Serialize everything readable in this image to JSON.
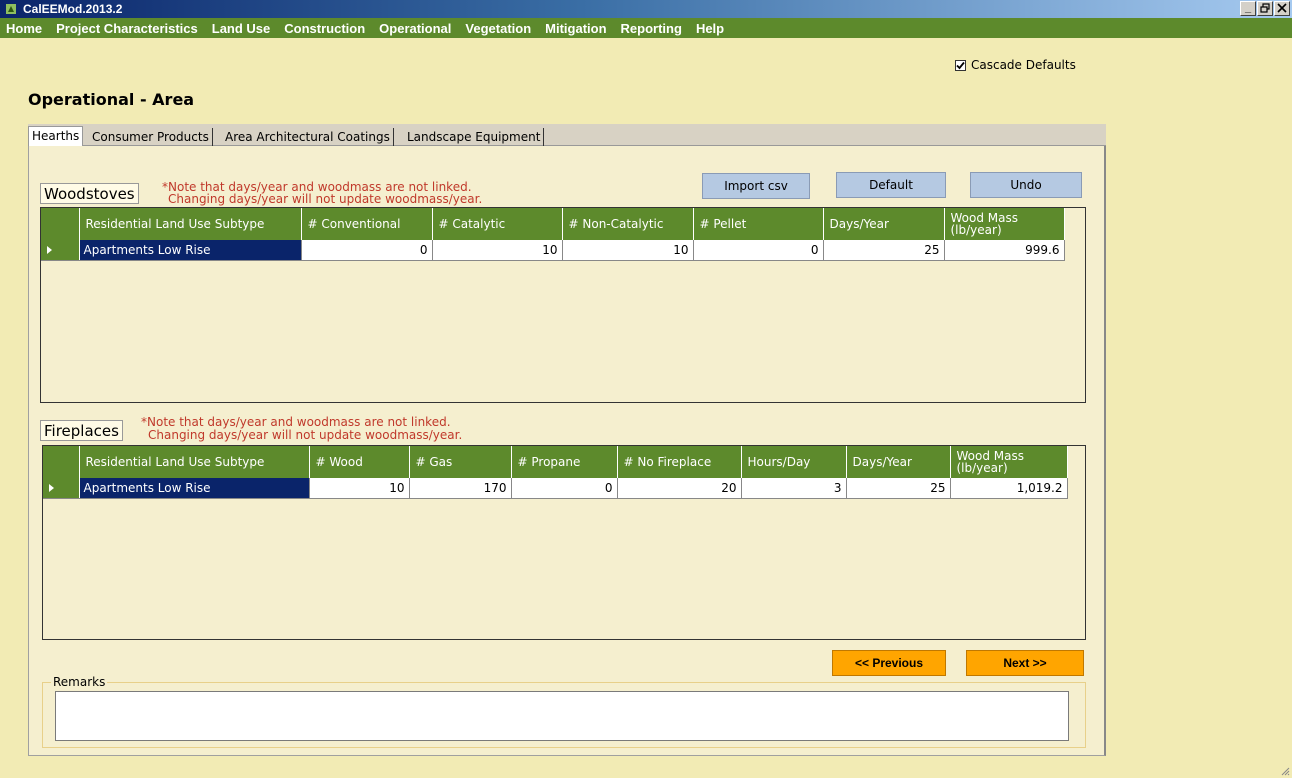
{
  "window": {
    "title": "CalEEMod.2013.2",
    "controls": [
      "_",
      " ",
      "x"
    ]
  },
  "menu": [
    "Home",
    "Project Characteristics",
    "Land Use",
    "Construction",
    "Operational",
    "Vegetation",
    "Mitigation",
    "Reporting",
    "Help"
  ],
  "cascade_defaults": {
    "label": "Cascade Defaults",
    "checked": true
  },
  "page_title": "Operational - Area",
  "tabs": [
    "Hearths",
    "Consumer Products",
    "Area Architectural Coatings",
    "Landscape Equipment"
  ],
  "active_tab": "Hearths",
  "buttons": {
    "import_csv": "Import csv",
    "default": "Default",
    "undo": "Undo",
    "previous": "<< Previous",
    "next": "Next >>"
  },
  "woodstoves": {
    "label": "Woodstoves",
    "note_line1": "*Note that days/year and woodmass are not linked.",
    "note_line2": "Changing days/year will not update woodmass/year.",
    "columns": [
      "Residential Land Use Subtype",
      "# Conventional",
      "# Catalytic",
      "# Non-Catalytic",
      "# Pellet",
      "Days/Year",
      "Wood Mass (lb/year)"
    ],
    "rows": [
      [
        "Apartments Low Rise",
        "0",
        "10",
        "10",
        "0",
        "25",
        "999.6"
      ]
    ]
  },
  "fireplaces": {
    "label": "Fireplaces",
    "note_line1": "*Note that days/year and woodmass are not linked.",
    "note_line2": "Changing days/year will not update woodmass/year.",
    "columns": [
      "Residential Land Use Subtype",
      "# Wood",
      "# Gas",
      "# Propane",
      "# No Fireplace",
      "Hours/Day",
      "Days/Year",
      "Wood Mass (lb/year)"
    ],
    "rows": [
      [
        "Apartments Low Rise",
        "10",
        "170",
        "0",
        "20",
        "3",
        "25",
        "1,019.2"
      ]
    ]
  },
  "remarks": {
    "label": "Remarks",
    "value": ""
  },
  "colors": {
    "menu_green": "#5d8a2c",
    "background": "#f2ebb4",
    "selected_cell": "#0a246a",
    "note_red": "#c0392b",
    "nav_orange": "#ffa500",
    "button_blue": "#b5c9e2"
  }
}
